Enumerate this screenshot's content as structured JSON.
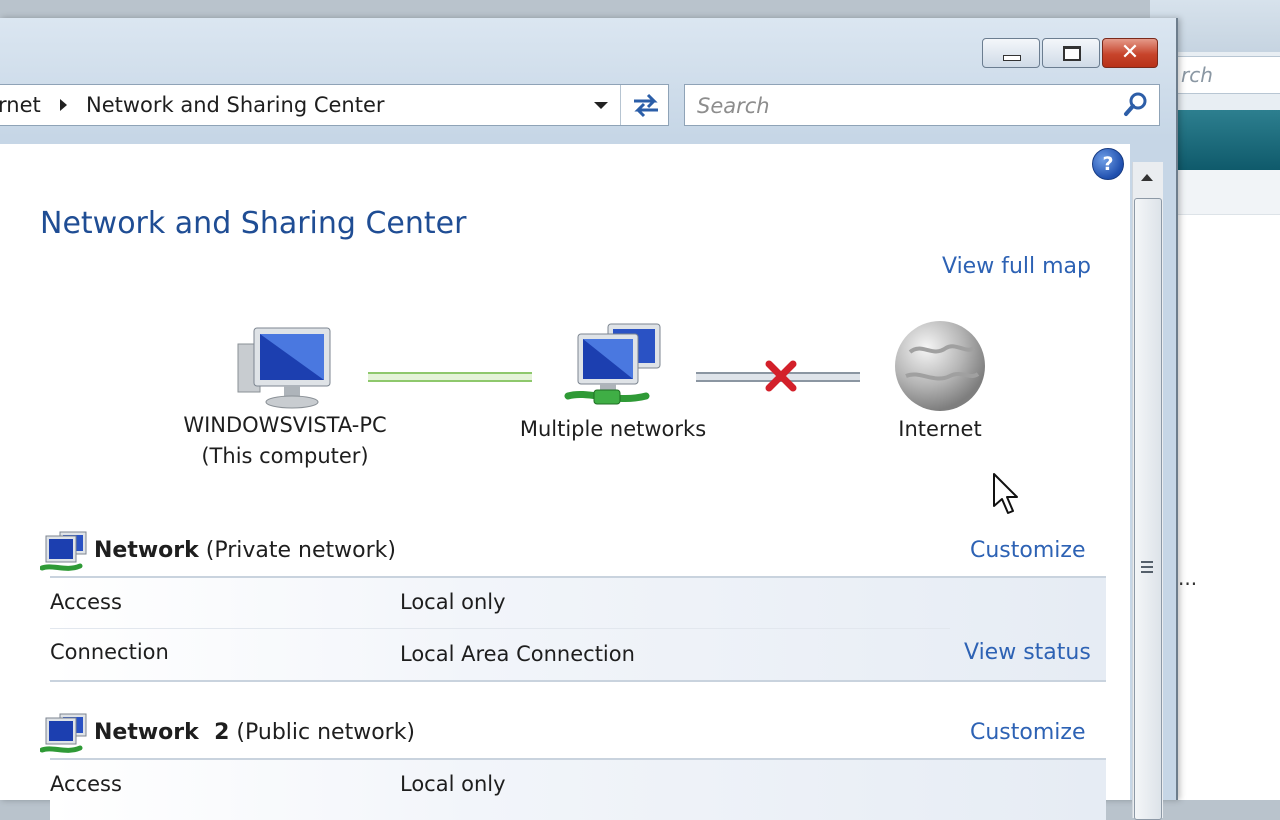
{
  "background_window": {
    "search_fragment": "rch",
    "ellipsis": "..."
  },
  "titlebar": {
    "buttons": [
      "minimize",
      "maximize",
      "close"
    ],
    "close_glyph": "✕"
  },
  "address_bar": {
    "crumb_prev": "rnet",
    "crumb_current": "Network and Sharing Center"
  },
  "search": {
    "placeholder": "Search"
  },
  "help_glyph": "?",
  "page": {
    "title": "Network and Sharing Center",
    "view_full_map": "View full map"
  },
  "map": {
    "computer_name": "WINDOWSVISTA-PC",
    "computer_note": "(This computer)",
    "networks_label": "Multiple networks",
    "internet_label": "Internet",
    "computer_to_networks": "connected",
    "networks_to_internet": "disconnected"
  },
  "networks": [
    {
      "name": "Network",
      "type": "(Private network)",
      "customize": "Customize",
      "rows": [
        {
          "label": "Access",
          "value": "Local only",
          "action": ""
        },
        {
          "label": "Connection",
          "value": "Local Area Connection",
          "action": "View status"
        }
      ]
    },
    {
      "name": "Network  2",
      "type": "(Public network)",
      "customize": "Customize",
      "rows": [
        {
          "label": "Access",
          "value": "Local only",
          "action": ""
        }
      ]
    }
  ],
  "colors": {
    "title_blue": "#1f4d94",
    "link_blue": "#2d62b4",
    "connected_green": "#8ec86c",
    "error_red": "#d3202a"
  }
}
